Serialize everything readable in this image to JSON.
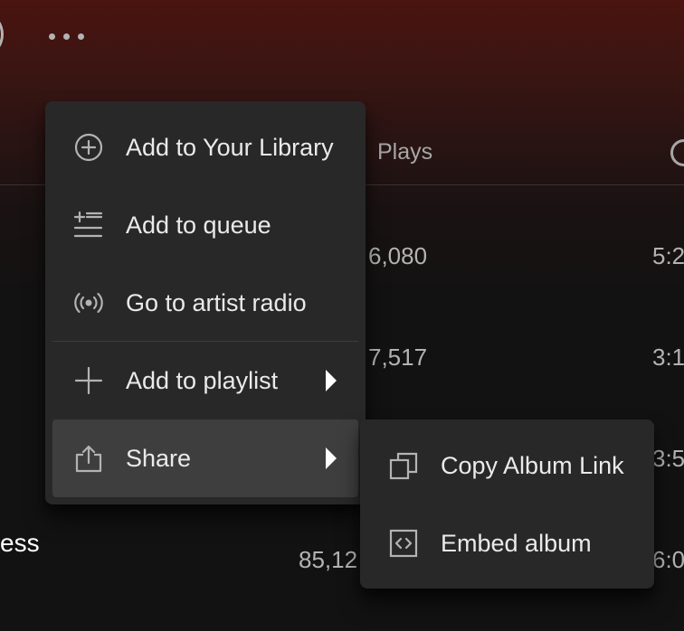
{
  "header": {
    "more_options_icon": "more-horizontal-icon"
  },
  "table": {
    "columns": {
      "plays": "Plays",
      "duration_icon": "clock-icon"
    },
    "rows": [
      {
        "title": "",
        "plays": "6,080",
        "duration": "5:2"
      },
      {
        "title": "",
        "plays": "7,517",
        "duration": "3:1"
      },
      {
        "title": "",
        "plays": "",
        "duration": "3:5"
      },
      {
        "title": "ess",
        "plays": "85,12",
        "duration": "6:0"
      }
    ]
  },
  "context_menu": {
    "items": [
      {
        "label": "Add to Your Library",
        "icon": "add-circle-icon"
      },
      {
        "label": "Add to queue",
        "icon": "add-to-queue-icon"
      },
      {
        "label": "Go to artist radio",
        "icon": "radio-icon"
      },
      {
        "label": "Add to playlist",
        "icon": "plus-icon",
        "submenu": true
      },
      {
        "label": "Share",
        "icon": "share-icon",
        "submenu": true,
        "active": true
      }
    ]
  },
  "share_submenu": {
    "items": [
      {
        "label": "Copy Album Link",
        "icon": "copy-icon"
      },
      {
        "label": "Embed album",
        "icon": "embed-icon"
      }
    ]
  },
  "colors": {
    "background": "#121212",
    "header_gradient": "#4a1410",
    "menu_bg": "#282828",
    "menu_active_bg": "#3e3e3e",
    "text_primary": "#ffffff",
    "text_secondary": "#b3b3b3"
  }
}
